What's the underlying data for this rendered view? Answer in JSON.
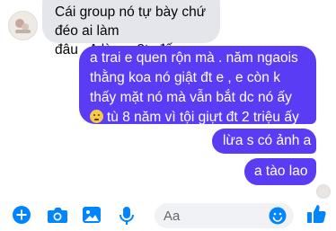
{
  "incoming": {
    "lines": [
      "Cái group nó tự bày chứ đéo ai làm",
      "đâu . A lừa e 2tr đấy"
    ]
  },
  "outgoing": [
    {
      "lines": [
        "a trai e quen rộn mà . năm ngaois",
        "thằng koa nó giật đt e , e còn k",
        "thấy mặt nó mà vẫn bắt dc nó ấy"
      ],
      "last_line": "tù 8 năm vì tội giựt đt 2 triệu ấy",
      "emoji": "slightly-frowning-face"
    },
    {
      "text": "lừa s có ảnh a"
    },
    {
      "text": "a tào lao"
    }
  ],
  "composer": {
    "placeholder": "Aa"
  },
  "icons": {
    "add": "plus-circle-icon",
    "camera": "camera-icon",
    "gallery": "photo-icon",
    "voice": "microphone-icon",
    "emoji": "smile-icon",
    "like": "thumbs-up-icon"
  },
  "colors": {
    "outgoing": "#5b3cf5",
    "incoming": "#e4e6eb",
    "accent": "#0084ff"
  }
}
